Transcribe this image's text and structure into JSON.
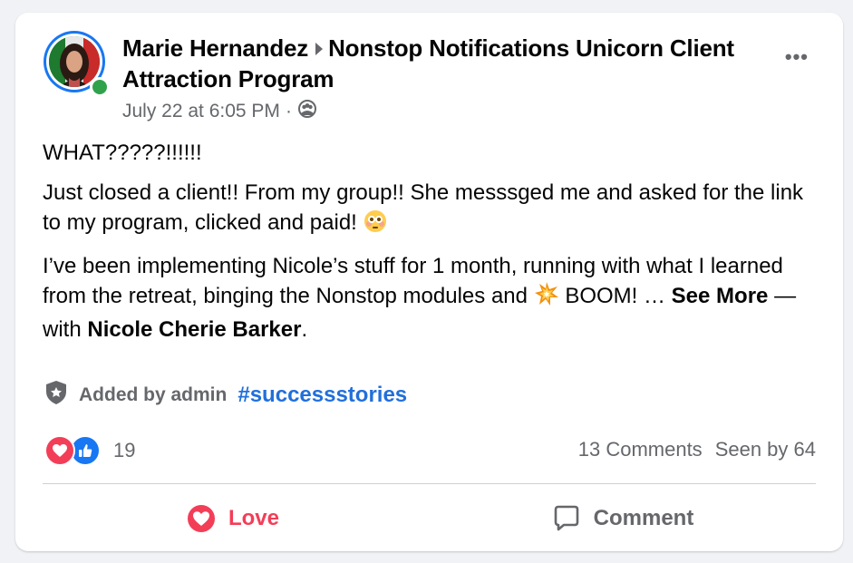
{
  "post": {
    "author": "Marie Hernandez",
    "group": "Nonstop Notifications Unicorn Client Attraction Program",
    "timestamp": "July 22 at 6:05 PM",
    "separator": "·",
    "audience_icon": "group-audience-icon",
    "body": {
      "line1": "WHAT?????!!!!!!",
      "para2": "Just closed a client!! From my group!! She messsged me and asked for the link to my program, clicked and paid!",
      "para2_emoji": "flushed-face-emoji",
      "para3_start": "I’ve been implementing Nicole’s stuff for 1 month, running with what I learned from the retreat, binging the Nonstop modules and",
      "para3_emoji": "collision-emoji",
      "para3_boom": "BOOM! …",
      "see_more": "See More",
      "with_text": "— with",
      "tagged": "Nicole Cherie Barker",
      "period": "."
    },
    "admin_label": "Added by admin",
    "admin_icon": "shield-icon",
    "hashtag": "#successstories"
  },
  "reactions": {
    "icons": [
      "love-reaction-icon",
      "like-reaction-icon"
    ],
    "count": "19"
  },
  "stats": {
    "comments": "13 Comments",
    "seen": "Seen by 64"
  },
  "actions": {
    "love": "Love",
    "comment": "Comment"
  },
  "colors": {
    "love": "#f33e58",
    "like": "#1877f2",
    "hashtag": "#216fdb",
    "online": "#31a24c",
    "secondary_text": "#65676b"
  }
}
